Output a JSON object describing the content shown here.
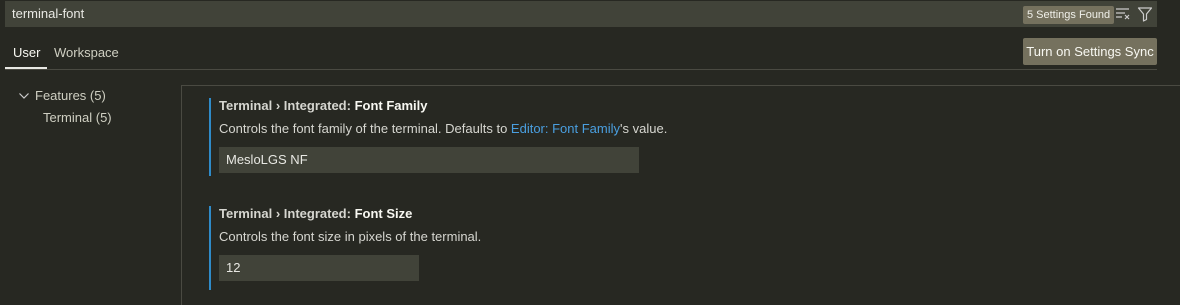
{
  "search": {
    "value": "terminal-font",
    "results_badge": "5 Settings Found",
    "clear_icon": "clear-filter-icon",
    "filter_icon": "filter-icon"
  },
  "tabs": [
    {
      "label": "User",
      "active": true
    },
    {
      "label": "Workspace",
      "active": false
    }
  ],
  "sync_button": {
    "label": "Turn on Settings Sync"
  },
  "toc": {
    "group_label": "Features (5)",
    "group_icon": "chevron-down-icon",
    "item_label": "Terminal (5)"
  },
  "settings": [
    {
      "category": "Terminal › Integrated: ",
      "name": "Font Family",
      "desc_before": "Controls the font family of the terminal. Defaults to ",
      "desc_link": "Editor: Font Family",
      "desc_after": "'s value.",
      "value": "MesloLGS NF"
    },
    {
      "category": "Terminal › Integrated: ",
      "name": "Font Size",
      "desc_before": "Controls the font size in pixels of the terminal.",
      "value": "12"
    }
  ],
  "colors": {
    "background": "#272822",
    "input_background": "#414339",
    "accent_bar": "#2f8bc9",
    "link": "#4a9fe0",
    "button": "#75715e"
  }
}
